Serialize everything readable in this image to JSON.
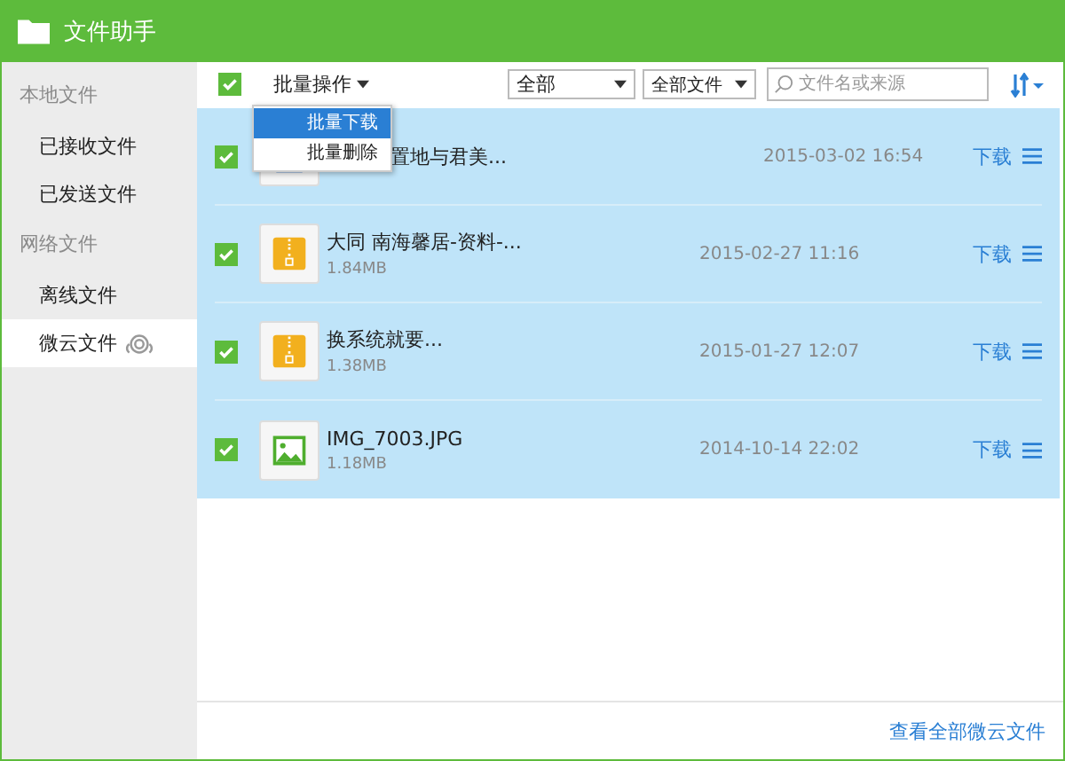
{
  "window": {
    "title": "文件助手"
  },
  "sidebar": {
    "sections": [
      {
        "heading": "本地文件",
        "items": [
          {
            "label": "已接收文件",
            "selected": false
          },
          {
            "label": "已发送文件",
            "selected": false
          }
        ]
      },
      {
        "heading": "网络文件",
        "items": [
          {
            "label": "离线文件",
            "selected": false
          },
          {
            "label": "微云文件",
            "selected": true
          }
        ]
      }
    ]
  },
  "toolbar": {
    "select_all_checked": true,
    "batch_label": "批量操作",
    "filter_1": "全部",
    "filter_2": "全部文件",
    "search": {
      "placeholder": "文件名或来源"
    }
  },
  "batch_menu": [
    {
      "label": "批量下载",
      "selected": true
    },
    {
      "label": "批量删除",
      "selected": false
    }
  ],
  "files": [
    {
      "kind": "doc",
      "name": "置地与君美...",
      "date": "2015-03-02 16:54",
      "action": "下载",
      "checked": true
    },
    {
      "kind": "zip",
      "name": "大同  南海馨居-资料-...",
      "size": "1.84MB",
      "date": "2015-02-27 11:16",
      "action": "下载",
      "checked": true
    },
    {
      "kind": "zip",
      "name": " 换系统就要...",
      "size": "1.38MB",
      "date": "2015-01-27 12:07",
      "action": "下载",
      "checked": true
    },
    {
      "kind": "image",
      "name": "IMG_7003.JPG",
      "size": "1.18MB",
      "date": "2014-10-14 22:02",
      "action": "下载",
      "checked": true
    }
  ],
  "footer_link": "查看全部微云文件"
}
